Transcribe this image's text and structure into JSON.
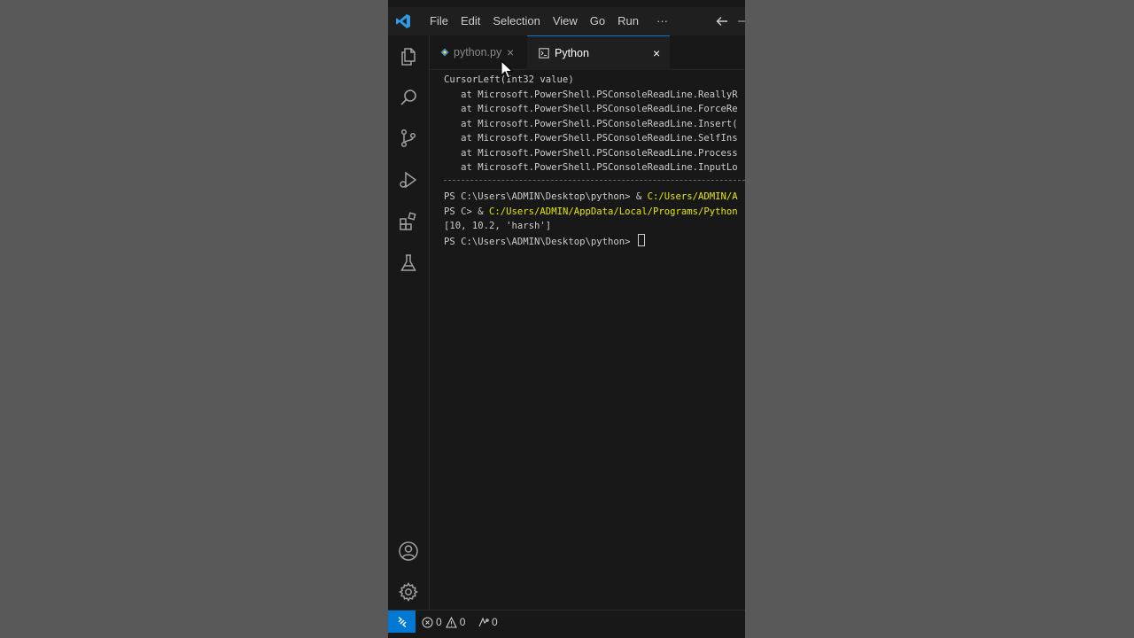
{
  "menu": {
    "items": [
      "File",
      "Edit",
      "Selection",
      "View",
      "Go",
      "Run"
    ],
    "more": "···"
  },
  "tabs": [
    {
      "label": "python.py",
      "close": "×"
    },
    {
      "label": "Python",
      "close": "×"
    }
  ],
  "terminal": {
    "lines": [
      "CursorLeft(Int32 value)",
      "   at Microsoft.PowerShell.PSConsoleReadLine.ReallyR",
      "   at Microsoft.PowerShell.PSConsoleReadLine.ForceRe",
      "   at Microsoft.PowerShell.PSConsoleReadLine.Insert(",
      "   at Microsoft.PowerShell.PSConsoleReadLine.SelfIns",
      "   at Microsoft.PowerShell.PSConsoleReadLine.Process",
      "   at Microsoft.PowerShell.PSConsoleReadLine.InputLo"
    ],
    "prompt1": "PS C:\\Users\\ADMIN\\Desktop\\python> & ",
    "prompt1_path": "C:/Users/ADMIN/A",
    "prompt2": "PS C> & ",
    "prompt2_path": "C:/Users/ADMIN/AppData/Local/Programs/Python",
    "output": "[10, 10.2, 'harsh']",
    "prompt3": "PS C:\\Users\\ADMIN\\Desktop\\python> "
  },
  "status": {
    "errors": "0",
    "warnings": "0",
    "ports": "0"
  },
  "colors": {
    "accent": "#0078d4",
    "terminal_path": "#e5e510",
    "background": "#181818"
  },
  "icons": {
    "activity": [
      "explorer-icon",
      "search-icon",
      "source-control-icon",
      "run-debug-icon",
      "extensions-icon",
      "testing-icon"
    ],
    "bottom": [
      "account-icon",
      "settings-gear-icon"
    ]
  }
}
